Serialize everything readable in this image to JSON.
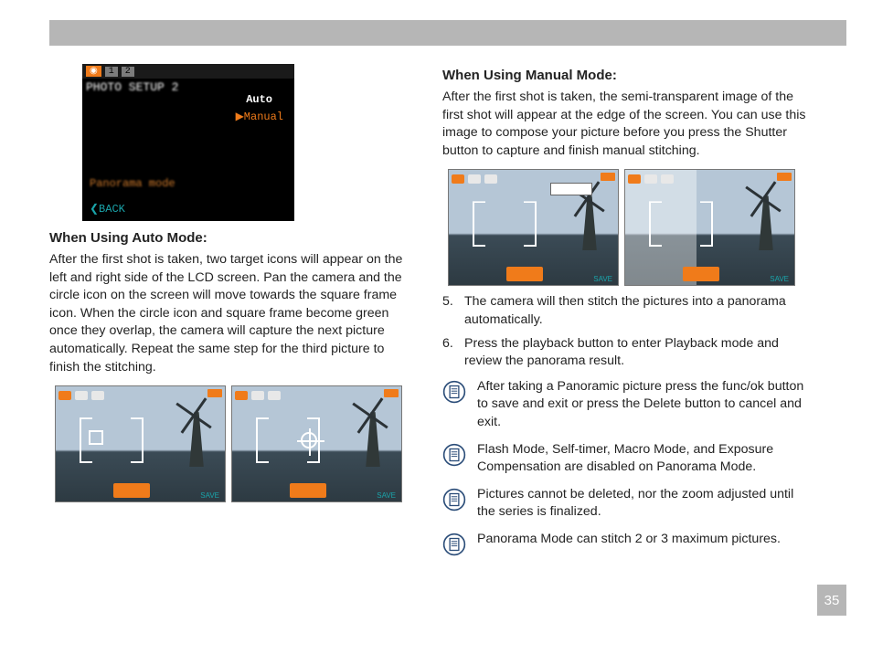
{
  "page_number": "35",
  "lcd": {
    "tab_1": "1",
    "tab_2": "2",
    "title": "PHOTO SETUP 2",
    "opt_auto": "Auto",
    "opt_manual": "▶Manual",
    "panorama": "Panorama mode",
    "back": "❮BACK"
  },
  "left": {
    "heading_auto": "When Using Auto Mode:",
    "para_auto": "After the first shot is taken, two target icons will appear on the left and right side of the LCD screen.  Pan the camera and the circle icon on the screen will move towards the square frame icon. When the circle icon and square frame become green once they overlap, the camera will capture the next picture automatically. Repeat the same step for the third picture to finish the stitching."
  },
  "right": {
    "heading_manual": "When Using Manual Mode:",
    "para_manual": "After the first shot is taken, the semi-transparent image of the first shot will appear at the edge of the screen. You can use this image to compose your picture before you press the Shutter button to capture and finish manual stitching.",
    "list": {
      "n5": "5.",
      "t5": "The camera will then stitch the pictures into a panorama automatically.",
      "n6": "6.",
      "t6": "Press the playback button to enter Playback mode and review the panorama result."
    },
    "notes": {
      "a": "After taking a Panoramic picture press the func/ok button to save and exit or press the Delete button to cancel and exit.",
      "b": "Flash Mode, Self-timer, Macro Mode, and Exposure Compensation are disabled on Panorama Mode.",
      "c": "Pictures cannot be deleted, nor the zoom adjusted until the series is finalized.",
      "d": "Panorama Mode can stitch 2 or 3 maximum pictures."
    }
  }
}
